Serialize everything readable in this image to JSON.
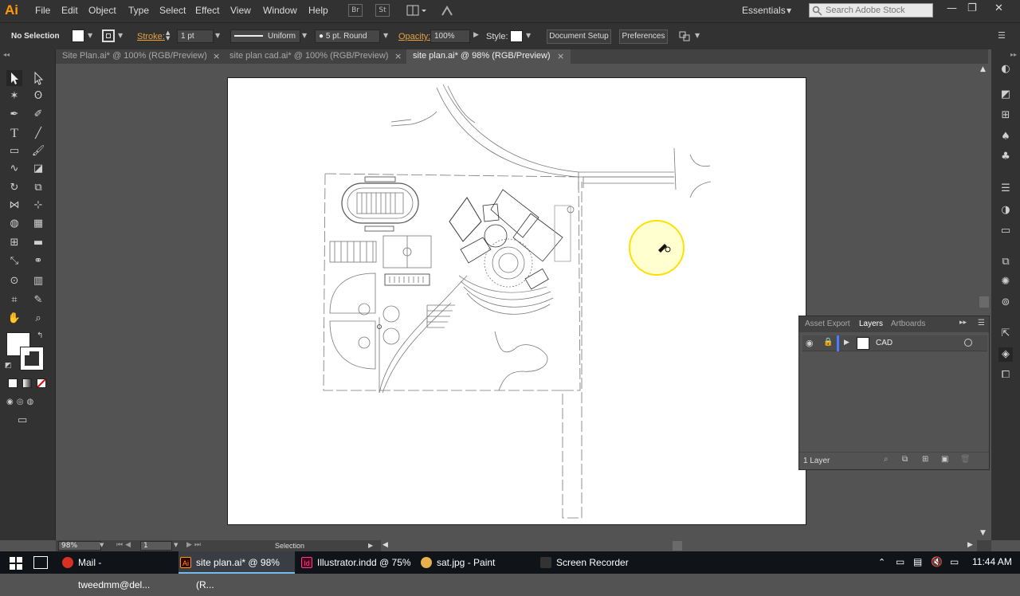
{
  "app": {
    "logo": "Ai"
  },
  "menu": [
    "File",
    "Edit",
    "Object",
    "Type",
    "Select",
    "Effect",
    "View",
    "Window",
    "Help"
  ],
  "menubar_buttons": {
    "br": "Br",
    "st": "St"
  },
  "workspace": "Essentials",
  "search": {
    "placeholder": "Search Adobe Stock"
  },
  "control": {
    "selection": "No Selection",
    "stroke_label": "Stroke:",
    "stroke_value": "1 pt",
    "profile": "Uniform",
    "brush": "5 pt. Round",
    "opacity_label": "Opacity:",
    "opacity_value": "100%",
    "style_label": "Style:",
    "document_setup": "Document Setup",
    "preferences": "Preferences"
  },
  "tabs": [
    {
      "label": "Site Plan.ai* @ 100% (RGB/Preview)"
    },
    {
      "label": "site plan cad.ai* @ 100% (RGB/Preview)"
    },
    {
      "label": "site plan.ai* @ 98% (RGB/Preview)"
    }
  ],
  "layers_panel": {
    "tabs": [
      "Asset Export",
      "Layers",
      "Artboards"
    ],
    "layer_name": "CAD",
    "layer_count": "1 Layer"
  },
  "status": {
    "zoom": "98%",
    "artboard": "1",
    "tool": "Selection"
  },
  "taskbar": {
    "items": [
      {
        "label": "Mail - tweedmm@del..."
      },
      {
        "label": "site plan.ai* @ 98% (R..."
      },
      {
        "label": "Illustrator.indd @ 75%"
      },
      {
        "label": "sat.jpg - Paint"
      },
      {
        "label": "Screen Recorder"
      }
    ],
    "clock": "11:44 AM"
  },
  "colors": {
    "accent": "#ff9a00",
    "stroke_label": "#e8a23b",
    "cursor_ring": "#ffe000",
    "layer_color": "#4b7bff"
  }
}
